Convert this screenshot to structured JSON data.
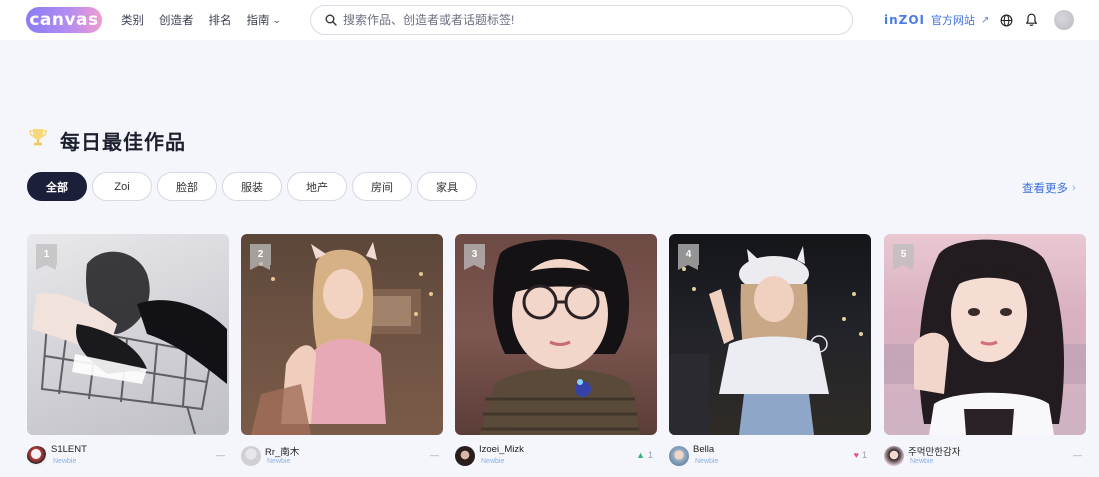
{
  "header": {
    "logo_text": "canvas",
    "nav": [
      {
        "label": "类别"
      },
      {
        "label": "创造者"
      },
      {
        "label": "排名"
      },
      {
        "label": "指南",
        "has_dropdown": true
      }
    ],
    "search_placeholder": "搜索作品、创造者或者话题标签!",
    "brand_logo": "inZOI",
    "brand_link": "官方网站",
    "icons": [
      "globe-icon",
      "bell-icon"
    ]
  },
  "section": {
    "title": "每日最佳作品",
    "filters": [
      {
        "label": "全部",
        "active": true
      },
      {
        "label": "Zoi"
      },
      {
        "label": "脸部"
      },
      {
        "label": "服装"
      },
      {
        "label": "地产"
      },
      {
        "label": "房间"
      },
      {
        "label": "家具"
      }
    ],
    "see_more": "查看更多"
  },
  "cards": [
    {
      "rank": "1",
      "author": "S1LENT",
      "level": "Newbie",
      "stat": "—",
      "stat_type": "none"
    },
    {
      "rank": "2",
      "author": "Rr_南木",
      "level": "Newbie",
      "stat": "—",
      "stat_type": "none"
    },
    {
      "rank": "3",
      "author": "Izoei_Mizk",
      "level": "Newbie",
      "stat": "1",
      "stat_type": "up"
    },
    {
      "rank": "4",
      "author": "Bella",
      "level": "Newbie",
      "stat": "1",
      "stat_type": "heart"
    },
    {
      "rank": "5",
      "author": "주먹만한감자",
      "level": "Newbie",
      "stat": "—",
      "stat_type": "none"
    }
  ],
  "colors": {
    "accent": "#3f6fe0",
    "active_pill": "#1c1f3a",
    "up": "#39b37a",
    "heart": "#e8557e"
  }
}
